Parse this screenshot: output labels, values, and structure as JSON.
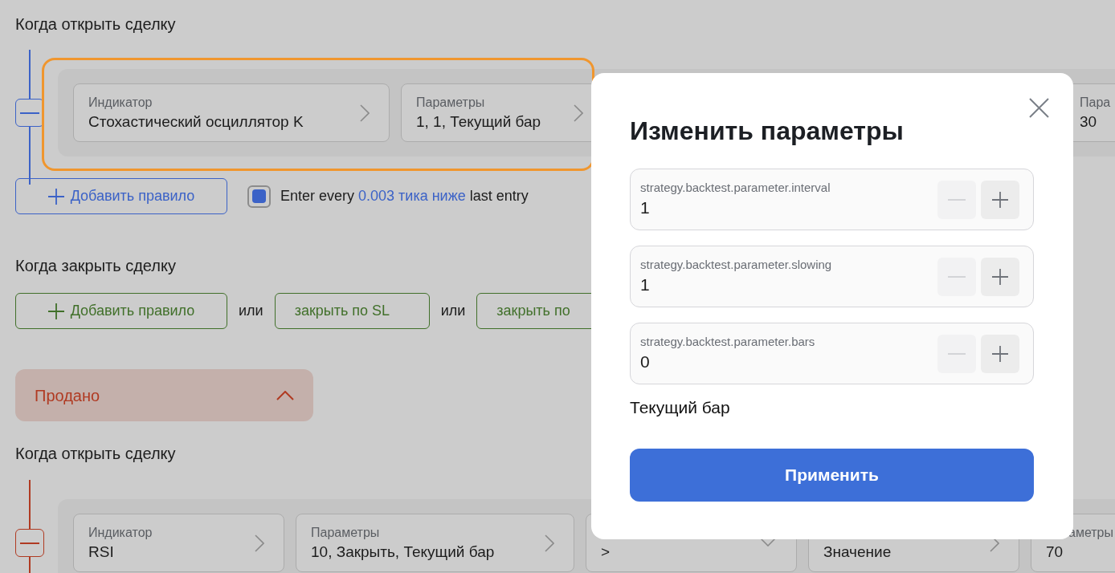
{
  "buy_open": {
    "heading": "Когда открыть сделку",
    "kind": "buy",
    "highlighted": true,
    "fields": [
      {
        "kind": "nav",
        "label": "Индикатор",
        "value": "Стохастический осциллятор K"
      },
      {
        "kind": "nav",
        "label": "Параметры",
        "value": "1, 1, Текущий бар"
      },
      {
        "kind": "partial",
        "label": "Пара",
        "value": "30"
      }
    ],
    "add_button": "Добавить правило",
    "entry_rule": {
      "checked": true,
      "before": "Enter every",
      "highlight": "0.003 тика ниже",
      "after": "last entry"
    }
  },
  "buy_close": {
    "heading": "Когда закрыть сделку",
    "items": [
      {
        "kind": "add",
        "label": "Добавить правило"
      },
      {
        "kind": "separator",
        "label": "или"
      },
      {
        "kind": "close",
        "label": "закрыть по SL"
      },
      {
        "kind": "separator",
        "label": "или"
      },
      {
        "kind": "close",
        "label": "закрыть по"
      }
    ]
  },
  "sold_panel": {
    "title": "Продано",
    "expanded": true
  },
  "sell_open": {
    "heading": "Когда открыть сделку",
    "kind": "sell",
    "fields": [
      {
        "kind": "nav",
        "label": "Индикатор",
        "value": "RSI"
      },
      {
        "kind": "nav",
        "label": "Параметры",
        "value": "10, Закрыть, Текущий бар"
      },
      {
        "kind": "select",
        "value": ">"
      },
      {
        "kind": "nav",
        "value": "Значение"
      },
      {
        "kind": "partial",
        "label": "аметры",
        "value": "70"
      }
    ]
  },
  "dialog": {
    "title": "Изменить параметры",
    "params": [
      {
        "label": "strategy.backtest.parameter.interval",
        "value": "1",
        "minus_disabled": true
      },
      {
        "label": "strategy.backtest.parameter.slowing",
        "value": "1",
        "minus_disabled": true
      },
      {
        "label": "strategy.backtest.parameter.bars",
        "value": "0",
        "minus_disabled": true
      }
    ],
    "note": "Текущий бар",
    "apply_button": "Применить"
  }
}
